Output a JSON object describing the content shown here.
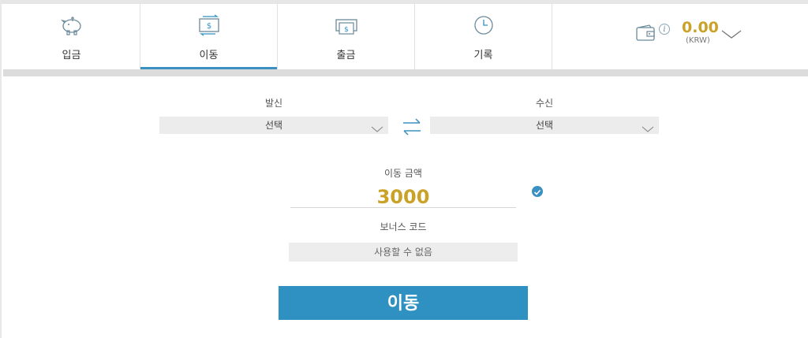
{
  "tabs": [
    {
      "label": "입금",
      "icon": "piggy-bank-icon"
    },
    {
      "label": "이동",
      "icon": "transfer-money-icon",
      "active": true
    },
    {
      "label": "출금",
      "icon": "withdraw-cash-icon"
    },
    {
      "label": "기록",
      "icon": "history-clock-icon"
    }
  ],
  "wallet": {
    "balance": "0.00",
    "currency": "(KRW)",
    "info_glyph": "i",
    "icon": "wallet-icon"
  },
  "transfer": {
    "from_label": "발신",
    "from_value": "선택",
    "to_label": "수신",
    "to_value": "선택",
    "swap_icon": "swap-arrows-icon"
  },
  "amount": {
    "label": "이동 금액",
    "value": "3000",
    "valid": true
  },
  "bonus": {
    "label": "보너스 코드",
    "placeholder": "사용할 수 없음"
  },
  "submit_label": "이동",
  "colors": {
    "accent": "#2f91c2",
    "amount": "#c9a227"
  }
}
